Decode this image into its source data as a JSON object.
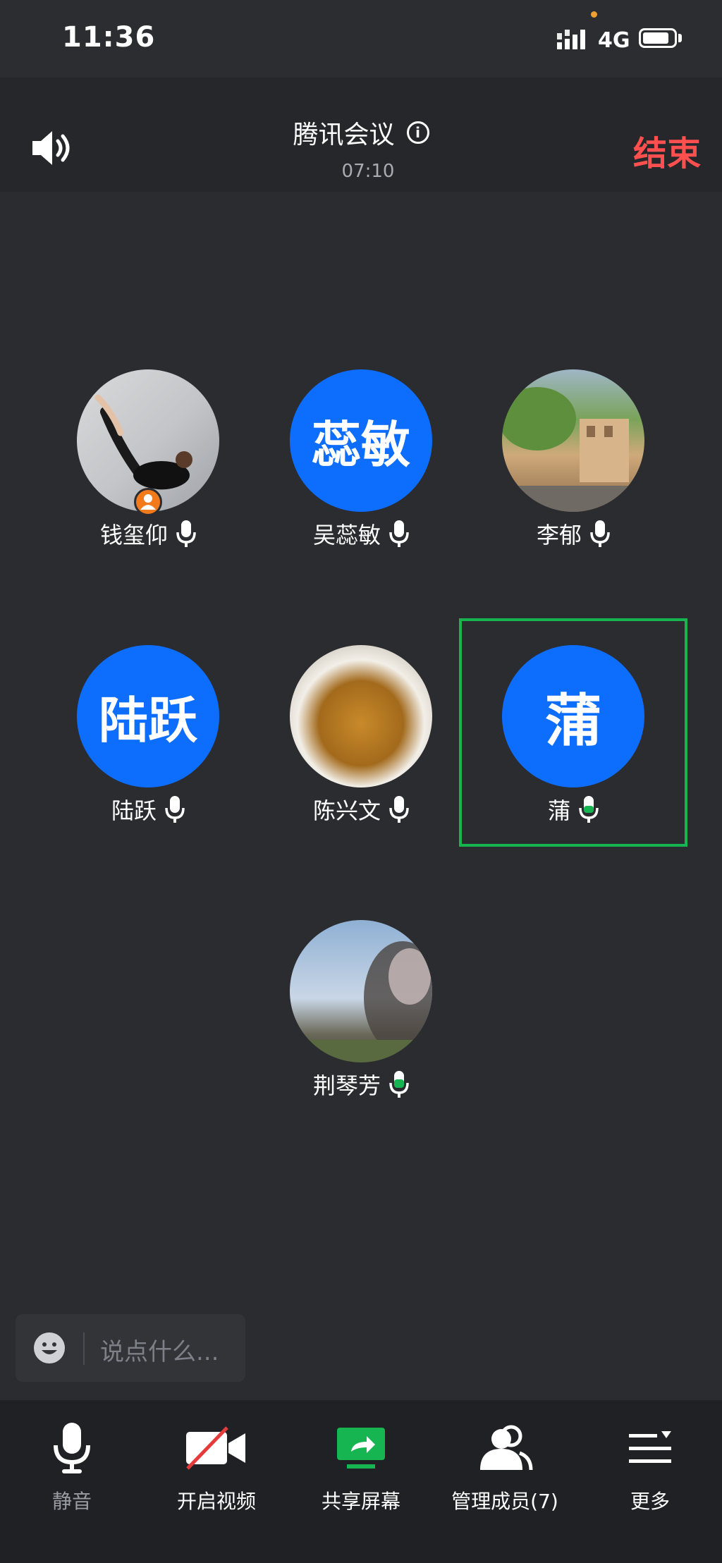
{
  "status_bar": {
    "time": "11:36",
    "network": "4G"
  },
  "header": {
    "title": "腾讯会议",
    "timer": "07:10",
    "end_label": "结束"
  },
  "participants": [
    {
      "name": "钱玺仰",
      "avatar_text": ""
    },
    {
      "name": "吴蕊敏",
      "avatar_text": "蕊敏"
    },
    {
      "name": "李郁",
      "avatar_text": ""
    },
    {
      "name": "陆跃",
      "avatar_text": "陆跃"
    },
    {
      "name": "陈兴文",
      "avatar_text": ""
    },
    {
      "name": "蒲",
      "avatar_text": "蒲"
    },
    {
      "name": "荆琴芳",
      "avatar_text": ""
    }
  ],
  "chat": {
    "placeholder": "说点什么..."
  },
  "toolbar": {
    "mute_label": "静音",
    "video_label": "开启视频",
    "share_label": "共享屏幕",
    "members_label": "管理成员(7)",
    "more_label": "更多"
  },
  "colors": {
    "accent_blue": "#0d6efd",
    "end_red": "#ff4f4f",
    "active_green": "#16b552",
    "host_orange": "#f27a1a"
  }
}
